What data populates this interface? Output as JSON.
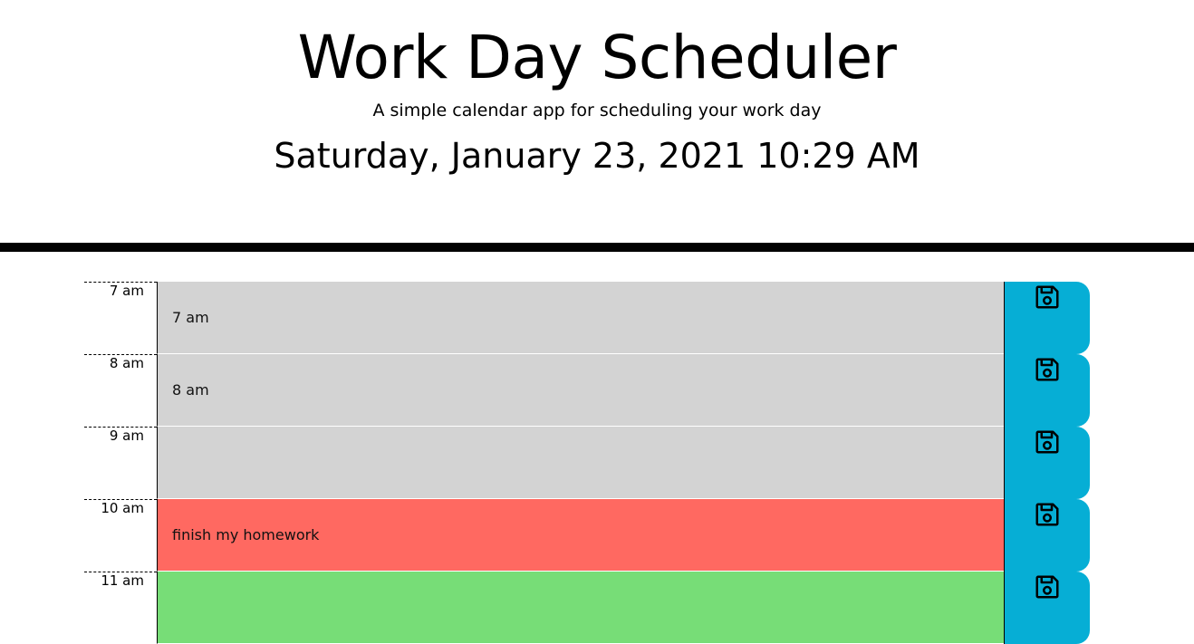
{
  "header": {
    "title": "Work Day Scheduler",
    "subtitle": "A simple calendar app for scheduling your work day",
    "current_day": "Saturday, January 23, 2021 10:29 AM"
  },
  "colors": {
    "past": "#d3d3d3",
    "present": "#ff6961",
    "future": "#77dd77",
    "save_button": "#06aed5"
  },
  "rows": [
    {
      "hour": "7 am",
      "task": "7 am",
      "status": "past",
      "save_icon": "floppy-disk-icon"
    },
    {
      "hour": "8 am",
      "task": "8 am",
      "status": "past",
      "save_icon": "floppy-disk-icon"
    },
    {
      "hour": "9 am",
      "task": "",
      "status": "past",
      "save_icon": "floppy-disk-icon"
    },
    {
      "hour": "10 am",
      "task": "finish my homework",
      "status": "present",
      "save_icon": "floppy-disk-icon"
    },
    {
      "hour": "11 am",
      "task": "",
      "status": "future",
      "save_icon": "floppy-disk-icon"
    }
  ]
}
